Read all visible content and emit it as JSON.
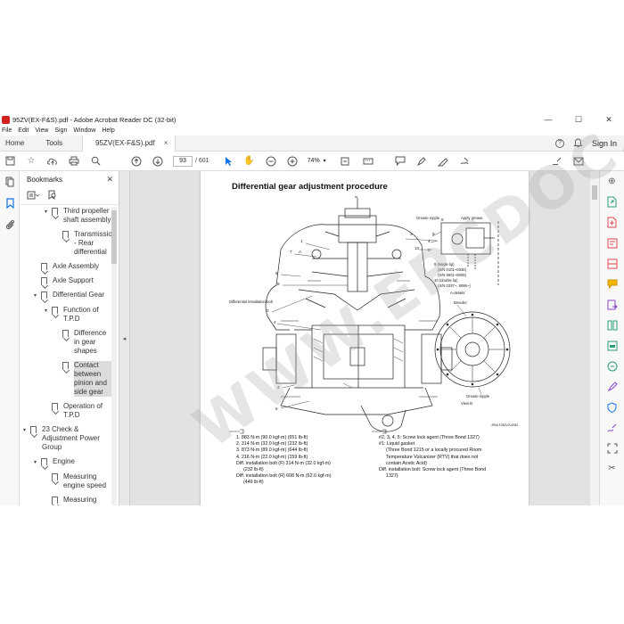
{
  "window": {
    "title": "95ZV(EX-F&S).pdf - Adobe Acrobat Reader DC (32-bit)",
    "controls": [
      "—",
      "☐",
      "✕"
    ]
  },
  "menu": [
    "File",
    "Edit",
    "View",
    "Sign",
    "Window",
    "Help"
  ],
  "tabs": {
    "home": "Home",
    "tools": "Tools",
    "document": "95ZV(EX-F&S).pdf",
    "close": "×",
    "help_icon": "?",
    "sign_in": "Sign In"
  },
  "toolbar": {
    "page_current": "93",
    "page_total": "/ 601",
    "zoom": "74%"
  },
  "bookmarks": {
    "title": "Bookmarks",
    "close": "✕",
    "items": [
      {
        "label": "Third propeller shaft assembly",
        "level": 2,
        "twisty": "▾"
      },
      {
        "label": "Transmission - Rear differential",
        "level": 3,
        "twisty": ""
      },
      {
        "label": "Axle Assembly",
        "level": 1,
        "twisty": ""
      },
      {
        "label": "Axle Support",
        "level": 1,
        "twisty": ""
      },
      {
        "label": "Differential Gear",
        "level": 1,
        "twisty": "▾"
      },
      {
        "label": "Function of T.P.D",
        "level": 2,
        "twisty": "▾"
      },
      {
        "label": "Difference in gear shapes",
        "level": 3,
        "twisty": ""
      },
      {
        "label": "Contact between pinion and side gear",
        "level": 3,
        "twisty": "",
        "selected": true
      },
      {
        "label": "Operation of T.P.D",
        "level": 2,
        "twisty": ""
      },
      {
        "label": "23 Check & Adjustment Power Group",
        "level": 0,
        "twisty": "▾"
      },
      {
        "label": "Engine",
        "level": 1,
        "twisty": "▾"
      },
      {
        "label": "Measuring engine speed",
        "level": 2,
        "twisty": ""
      },
      {
        "label": "Measuring",
        "level": 2,
        "twisty": ""
      }
    ]
  },
  "document": {
    "title": "Differential gear adjustment procedure",
    "diagram_labels": {
      "grease_nipple": "Grease nipple",
      "apply_grease": "Apply grease.",
      "a_detail": "A-details",
      "single_lip": "9 (single lip)",
      "sn1": "(S/N 0101~0336)",
      "sn2": "(S/N 6601~6006)",
      "double_lip": "10 (double lip)",
      "sn3": "(S/N 0337~, 9096~)",
      "diff_bolt": "Differential installation bolt",
      "breeder": "Breeder",
      "grease_nipple2": "Grease nipple",
      "view_b": "View B",
      "code": "JPAA F28ZV2U2082"
    },
    "notes_left": [
      "1. 883 N-m (90.0 kgf-m) (651 lb-ft)",
      "2. 314 N-m (32.0 kgf-m) (232 lb-ft)",
      "3. 873 N-m (89.0 kgf-m) (644 lb-ft)",
      "4. 216 N-m (22.0 kgf-m) (159 lb-ft)",
      "Diff. installation bolt (F) 314 N-m (32.0 kgf-m)",
      "(232 lb-ft)",
      "Diff. installation bolt (R) 608 N-m (62.0 kgf-m)",
      "(449 lb-ft)"
    ],
    "notes_right": [
      "#2, 3, 4, 5: Screw lock agent (Three Bond 1327)",
      "#1: Liquid gasket",
      "(Three Bond 1215 or a locally procured Room",
      "Temperature Vulcanizer (RTV) that does not",
      "contain Acetic Acid)",
      "Diff. installation bolt: Screw lock agent (Three Bond",
      "1327)"
    ]
  },
  "watermark": "WWW.EPCDOC.COM"
}
